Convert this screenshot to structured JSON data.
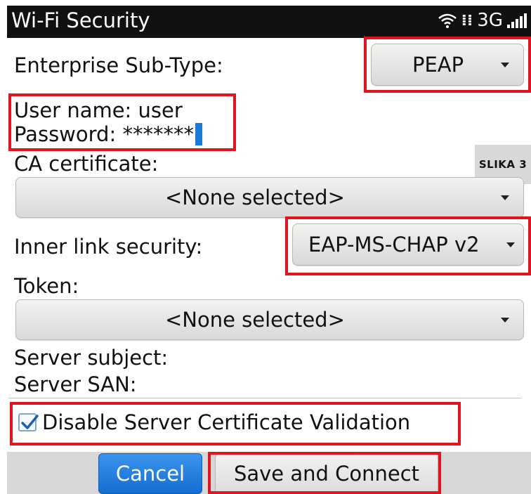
{
  "titlebar": {
    "title": "Wi-Fi Security",
    "network": "3G",
    "icons": [
      "wifi-icon",
      "bbm-icon",
      "signal-icon"
    ]
  },
  "form": {
    "enterprise_subtype_label": "Enterprise Sub-Type:",
    "enterprise_subtype_value": "PEAP",
    "username_label": "User name: user",
    "password_label": "Password: *******",
    "ca_certificate_label": "CA certificate:",
    "ca_certificate_value": "<None selected>",
    "inner_link_label": "Inner link security:",
    "inner_link_value": "EAP-MS-CHAP v2",
    "token_label": "Token:",
    "token_value": "<None selected>",
    "server_subject_label": "Server subject:",
    "server_san_label": "Server SAN:",
    "disable_validation_label": "Disable Server Certificate Validation",
    "disable_validation_checked": true
  },
  "overlay": {
    "slika_label": "SLIKA 3"
  },
  "buttons": {
    "cancel": "Cancel",
    "save": "Save and Connect"
  },
  "colors": {
    "highlight": "#e2141f",
    "primary_button": "#1f7ad9",
    "cursor": "#1a78d6"
  }
}
